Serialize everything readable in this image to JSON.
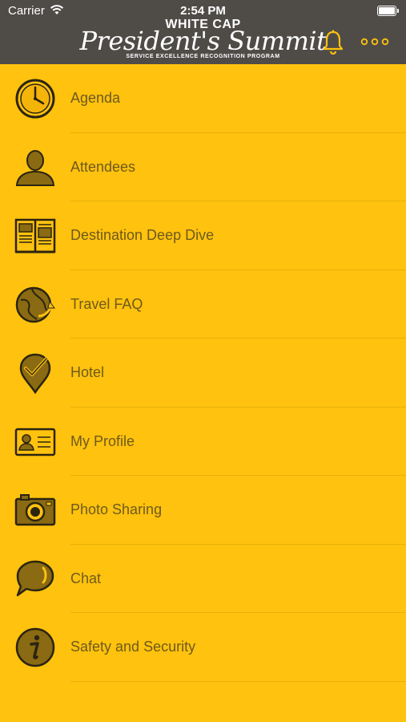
{
  "status_bar": {
    "carrier": "Carrier",
    "time": "2:54 PM"
  },
  "header": {
    "logo_top": "WHITE CAP",
    "logo_script": "President's Summit",
    "logo_bottom": "SERVICE EXCELLENCE RECOGNITION PROGRAM",
    "bell_icon": "bell-icon",
    "more_icon": "more-horizontal-icon",
    "accent_color": "#FFC20E",
    "header_color": "#4F4C48"
  },
  "menu": {
    "items": [
      {
        "label": "Agenda",
        "icon": "clock-icon"
      },
      {
        "label": "Attendees",
        "icon": "person-icon"
      },
      {
        "label": "Destination Deep Dive",
        "icon": "open-book-icon"
      },
      {
        "label": "Travel FAQ",
        "icon": "globe-arrow-icon"
      },
      {
        "label": "Hotel",
        "icon": "map-pin-check-icon"
      },
      {
        "label": "My Profile",
        "icon": "id-card-icon"
      },
      {
        "label": "Photo Sharing",
        "icon": "camera-icon"
      },
      {
        "label": "Chat",
        "icon": "chat-bubble-icon"
      },
      {
        "label": "Safety and Security",
        "icon": "info-icon"
      }
    ]
  }
}
